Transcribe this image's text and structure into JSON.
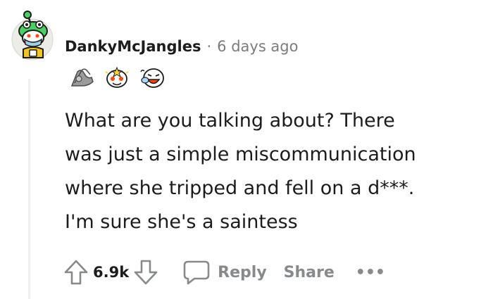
{
  "comment": {
    "username": "DankyMcJangles",
    "separator": "·",
    "timestamp": "6 days ago",
    "awards": [
      "hands-award-icon",
      "starstruck-award-icon",
      "laughing-award-icon"
    ],
    "body_lines": [
      "What are you talking about? There",
      "was just a simple miscommunication",
      "where she tripped and fell on a d***.",
      "I'm sure she's a saintess"
    ]
  },
  "actions": {
    "score": "6.9k",
    "reply_label": "Reply",
    "share_label": "Share",
    "more_label": "•••"
  },
  "colors": {
    "text": "#1c1c1c",
    "meta": "#7c7c7c",
    "action": "#878a8c",
    "thread_line": "#edeff1",
    "avatar_green": "#46d160"
  }
}
